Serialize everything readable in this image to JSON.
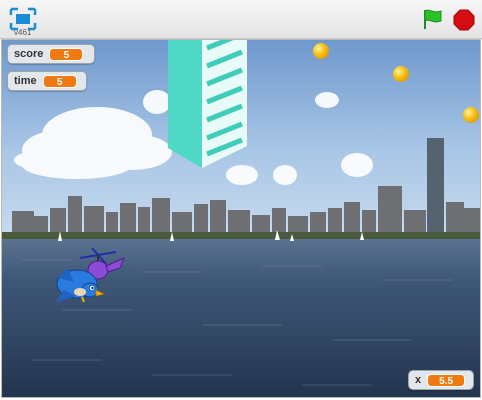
{
  "player": {
    "version": "v461",
    "fullscreen_icon": "fullscreen-icon",
    "green_flag_icon": "green-flag-icon",
    "stop_icon": "stop-sign-icon"
  },
  "monitors": {
    "score": {
      "label": "score",
      "value": "5"
    },
    "time": {
      "label": "time",
      "value": "5"
    },
    "x": {
      "label": "x",
      "value": "5.5"
    }
  },
  "colors": {
    "monitor_value": "#ef7a10",
    "flag": "#29c22a",
    "stop": "#d40d12",
    "fullscreen": "#1a8bd6",
    "sky": "#7ea9d9",
    "water": "#2f4563",
    "tower": "#4fd8c6",
    "coin": "#f6b707"
  }
}
